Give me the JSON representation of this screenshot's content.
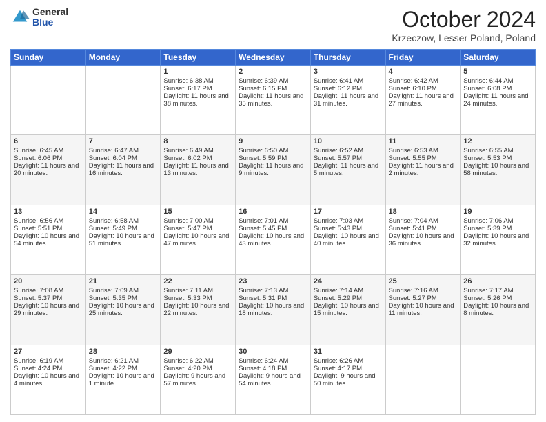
{
  "logo": {
    "general": "General",
    "blue": "Blue"
  },
  "header": {
    "month": "October 2024",
    "location": "Krzeczow, Lesser Poland, Poland"
  },
  "weekdays": [
    "Sunday",
    "Monday",
    "Tuesday",
    "Wednesday",
    "Thursday",
    "Friday",
    "Saturday"
  ],
  "weeks": [
    [
      {
        "day": "",
        "sunrise": "",
        "sunset": "",
        "daylight": ""
      },
      {
        "day": "",
        "sunrise": "",
        "sunset": "",
        "daylight": ""
      },
      {
        "day": "1",
        "sunrise": "Sunrise: 6:38 AM",
        "sunset": "Sunset: 6:17 PM",
        "daylight": "Daylight: 11 hours and 38 minutes."
      },
      {
        "day": "2",
        "sunrise": "Sunrise: 6:39 AM",
        "sunset": "Sunset: 6:15 PM",
        "daylight": "Daylight: 11 hours and 35 minutes."
      },
      {
        "day": "3",
        "sunrise": "Sunrise: 6:41 AM",
        "sunset": "Sunset: 6:12 PM",
        "daylight": "Daylight: 11 hours and 31 minutes."
      },
      {
        "day": "4",
        "sunrise": "Sunrise: 6:42 AM",
        "sunset": "Sunset: 6:10 PM",
        "daylight": "Daylight: 11 hours and 27 minutes."
      },
      {
        "day": "5",
        "sunrise": "Sunrise: 6:44 AM",
        "sunset": "Sunset: 6:08 PM",
        "daylight": "Daylight: 11 hours and 24 minutes."
      }
    ],
    [
      {
        "day": "6",
        "sunrise": "Sunrise: 6:45 AM",
        "sunset": "Sunset: 6:06 PM",
        "daylight": "Daylight: 11 hours and 20 minutes."
      },
      {
        "day": "7",
        "sunrise": "Sunrise: 6:47 AM",
        "sunset": "Sunset: 6:04 PM",
        "daylight": "Daylight: 11 hours and 16 minutes."
      },
      {
        "day": "8",
        "sunrise": "Sunrise: 6:49 AM",
        "sunset": "Sunset: 6:02 PM",
        "daylight": "Daylight: 11 hours and 13 minutes."
      },
      {
        "day": "9",
        "sunrise": "Sunrise: 6:50 AM",
        "sunset": "Sunset: 5:59 PM",
        "daylight": "Daylight: 11 hours and 9 minutes."
      },
      {
        "day": "10",
        "sunrise": "Sunrise: 6:52 AM",
        "sunset": "Sunset: 5:57 PM",
        "daylight": "Daylight: 11 hours and 5 minutes."
      },
      {
        "day": "11",
        "sunrise": "Sunrise: 6:53 AM",
        "sunset": "Sunset: 5:55 PM",
        "daylight": "Daylight: 11 hours and 2 minutes."
      },
      {
        "day": "12",
        "sunrise": "Sunrise: 6:55 AM",
        "sunset": "Sunset: 5:53 PM",
        "daylight": "Daylight: 10 hours and 58 minutes."
      }
    ],
    [
      {
        "day": "13",
        "sunrise": "Sunrise: 6:56 AM",
        "sunset": "Sunset: 5:51 PM",
        "daylight": "Daylight: 10 hours and 54 minutes."
      },
      {
        "day": "14",
        "sunrise": "Sunrise: 6:58 AM",
        "sunset": "Sunset: 5:49 PM",
        "daylight": "Daylight: 10 hours and 51 minutes."
      },
      {
        "day": "15",
        "sunrise": "Sunrise: 7:00 AM",
        "sunset": "Sunset: 5:47 PM",
        "daylight": "Daylight: 10 hours and 47 minutes."
      },
      {
        "day": "16",
        "sunrise": "Sunrise: 7:01 AM",
        "sunset": "Sunset: 5:45 PM",
        "daylight": "Daylight: 10 hours and 43 minutes."
      },
      {
        "day": "17",
        "sunrise": "Sunrise: 7:03 AM",
        "sunset": "Sunset: 5:43 PM",
        "daylight": "Daylight: 10 hours and 40 minutes."
      },
      {
        "day": "18",
        "sunrise": "Sunrise: 7:04 AM",
        "sunset": "Sunset: 5:41 PM",
        "daylight": "Daylight: 10 hours and 36 minutes."
      },
      {
        "day": "19",
        "sunrise": "Sunrise: 7:06 AM",
        "sunset": "Sunset: 5:39 PM",
        "daylight": "Daylight: 10 hours and 32 minutes."
      }
    ],
    [
      {
        "day": "20",
        "sunrise": "Sunrise: 7:08 AM",
        "sunset": "Sunset: 5:37 PM",
        "daylight": "Daylight: 10 hours and 29 minutes."
      },
      {
        "day": "21",
        "sunrise": "Sunrise: 7:09 AM",
        "sunset": "Sunset: 5:35 PM",
        "daylight": "Daylight: 10 hours and 25 minutes."
      },
      {
        "day": "22",
        "sunrise": "Sunrise: 7:11 AM",
        "sunset": "Sunset: 5:33 PM",
        "daylight": "Daylight: 10 hours and 22 minutes."
      },
      {
        "day": "23",
        "sunrise": "Sunrise: 7:13 AM",
        "sunset": "Sunset: 5:31 PM",
        "daylight": "Daylight: 10 hours and 18 minutes."
      },
      {
        "day": "24",
        "sunrise": "Sunrise: 7:14 AM",
        "sunset": "Sunset: 5:29 PM",
        "daylight": "Daylight: 10 hours and 15 minutes."
      },
      {
        "day": "25",
        "sunrise": "Sunrise: 7:16 AM",
        "sunset": "Sunset: 5:27 PM",
        "daylight": "Daylight: 10 hours and 11 minutes."
      },
      {
        "day": "26",
        "sunrise": "Sunrise: 7:17 AM",
        "sunset": "Sunset: 5:26 PM",
        "daylight": "Daylight: 10 hours and 8 minutes."
      }
    ],
    [
      {
        "day": "27",
        "sunrise": "Sunrise: 6:19 AM",
        "sunset": "Sunset: 4:24 PM",
        "daylight": "Daylight: 10 hours and 4 minutes."
      },
      {
        "day": "28",
        "sunrise": "Sunrise: 6:21 AM",
        "sunset": "Sunset: 4:22 PM",
        "daylight": "Daylight: 10 hours and 1 minute."
      },
      {
        "day": "29",
        "sunrise": "Sunrise: 6:22 AM",
        "sunset": "Sunset: 4:20 PM",
        "daylight": "Daylight: 9 hours and 57 minutes."
      },
      {
        "day": "30",
        "sunrise": "Sunrise: 6:24 AM",
        "sunset": "Sunset: 4:18 PM",
        "daylight": "Daylight: 9 hours and 54 minutes."
      },
      {
        "day": "31",
        "sunrise": "Sunrise: 6:26 AM",
        "sunset": "Sunset: 4:17 PM",
        "daylight": "Daylight: 9 hours and 50 minutes."
      },
      {
        "day": "",
        "sunrise": "",
        "sunset": "",
        "daylight": ""
      },
      {
        "day": "",
        "sunrise": "",
        "sunset": "",
        "daylight": ""
      }
    ]
  ]
}
